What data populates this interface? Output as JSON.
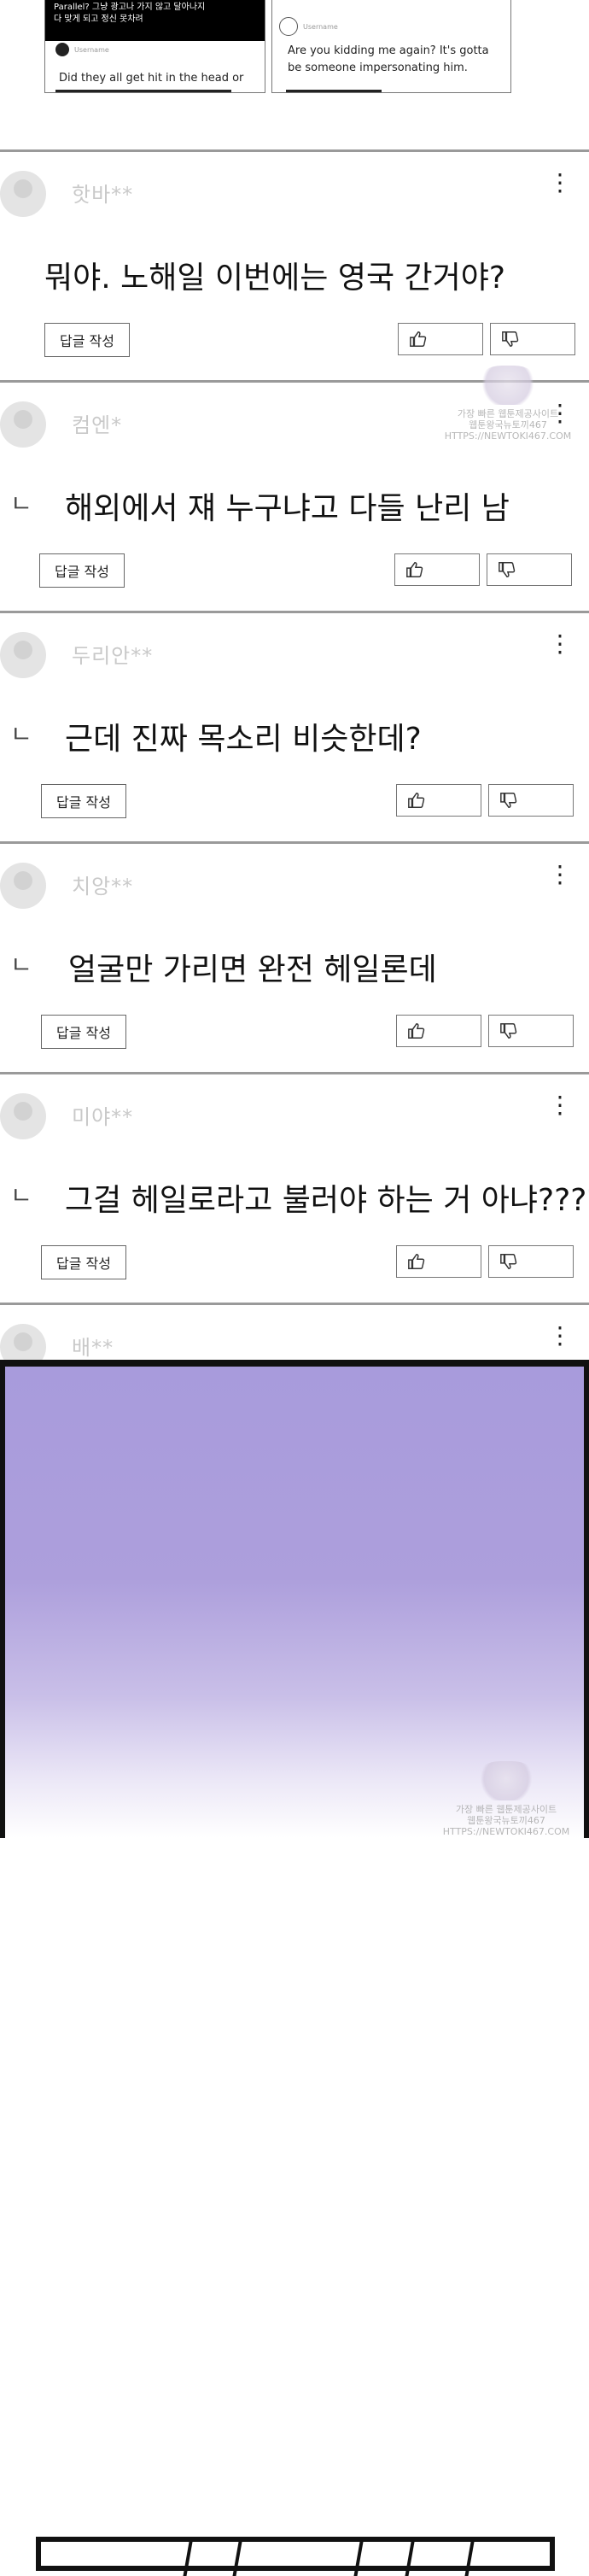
{
  "top_cards": {
    "left": {
      "dark_text_line1": "Parallel? 그냥 광고나 가지 않고 달아나지",
      "dark_text_line2": "다 맞게 되고 정신 못차려",
      "meta": "Username",
      "text": "Did they all get hit in the head or"
    },
    "right": {
      "meta": "Username",
      "text": "Are you kidding me again? It's gotta be someone impersonating him."
    }
  },
  "labels": {
    "reply_button": "답글 작성",
    "kebab": "⋮",
    "reply_mark": "ㄴ"
  },
  "comments": [
    {
      "username": "핫바**",
      "text": "뭐야. 노해일 이번에는 영국 간거야?",
      "is_reply": false
    },
    {
      "username": "컴엔*",
      "text": "해외에서 쟤 누구냐고 다들 난리 남",
      "is_reply": true
    },
    {
      "username": "두리안**",
      "text": "근데 진짜 목소리 비슷한데?",
      "is_reply": true
    },
    {
      "username": "치앙**",
      "text": "얼굴만 가리면 완전 헤일론데",
      "is_reply": true
    },
    {
      "username": "미야**",
      "text": "그걸 헤일로라고 불러야 하는 거 아냐????",
      "is_reply": true
    },
    {
      "username": "배**",
      "text": "",
      "is_reply": false
    }
  ],
  "watermark": {
    "line1": "가장 빠른 웹툰제공사이트",
    "line2": "웹툰왕국뉴토끼467",
    "line3": "HTTPS://NEWTOKI467.COM"
  },
  "colors": {
    "panel_purple": "#a89bdc",
    "divider": "#9a9a9a",
    "username_gray": "#c9c9c9"
  },
  "icons": {
    "thumb_up": "thumbs-up-icon",
    "thumb_down": "thumbs-down-icon",
    "kebab": "more-vertical-icon"
  }
}
